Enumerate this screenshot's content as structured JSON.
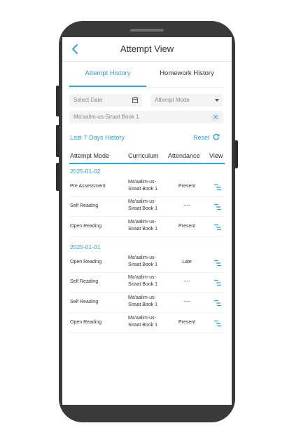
{
  "header": {
    "title": "Attempt View"
  },
  "tabs": [
    {
      "label": "Attempt History",
      "active": true
    },
    {
      "label": "Homework History",
      "active": false
    }
  ],
  "filters": {
    "date_placeholder": "Select Date",
    "mode_placeholder": "Attempt Mode",
    "curriculum_value": "Ma'aalim-us-Siraat Book 1"
  },
  "links": {
    "last7": "Last 7 Days History",
    "reset": "Reset"
  },
  "table": {
    "headers": [
      "Attempt Mode",
      "Curriculum",
      "Attendance",
      "View"
    ],
    "groups": [
      {
        "date": "2025-01-02",
        "rows": [
          {
            "mode": "Pre Assessment",
            "curriculum_1": "Ma'aalim-us-",
            "curriculum_2": "Siraat Book 1",
            "attendance": "Present"
          },
          {
            "mode": "Self Reading",
            "curriculum_1": "Ma'aalim-us-",
            "curriculum_2": "Siraat Book 1",
            "attendance": "----"
          },
          {
            "mode": "Open Reading",
            "curriculum_1": "Ma'aalim-us-",
            "curriculum_2": "Siraat Book 1",
            "attendance": "Present"
          }
        ]
      },
      {
        "date": "2025-01-01",
        "rows": [
          {
            "mode": "Open Reading",
            "curriculum_1": "Ma'aalim-us-",
            "curriculum_2": "Siraat Book 1",
            "attendance": "Late"
          },
          {
            "mode": "Self Reading",
            "curriculum_1": "Ma'aalim-us-",
            "curriculum_2": "Siraat Book 1",
            "attendance": "----"
          },
          {
            "mode": "Self Reading",
            "curriculum_1": "Ma'aalim-us-",
            "curriculum_2": "Siraat Book 1",
            "attendance": "----"
          },
          {
            "mode": "Open Reading",
            "curriculum_1": "Ma'aalim-us-",
            "curriculum_2": "Siraat Book 1",
            "attendance": "Present"
          }
        ]
      }
    ]
  },
  "colors": {
    "accent": "#3a9fd8",
    "phone_frame": "#3a3a3a"
  },
  "icons": [
    "back-arrow-icon",
    "calendar-icon",
    "dropdown-arrow-icon",
    "clear-icon",
    "refresh-icon",
    "view-list-icon"
  ]
}
